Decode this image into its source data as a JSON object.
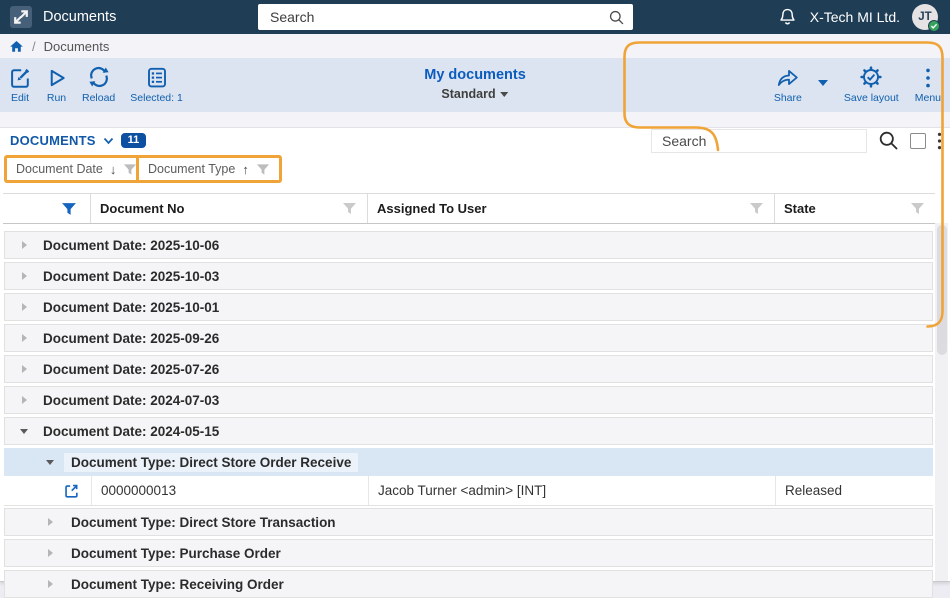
{
  "topbar": {
    "app_title": "Documents",
    "search_placeholder": "Search",
    "company": "X-Tech MI Ltd.",
    "avatar_initials": "JT"
  },
  "breadcrumb": {
    "separator": "/",
    "current": "Documents"
  },
  "toolbar": {
    "left": [
      {
        "label": "Edit"
      },
      {
        "label": "Run"
      },
      {
        "label": "Reload"
      },
      {
        "label": "Selected: 1"
      }
    ],
    "center": {
      "title": "My documents",
      "subtitle": "Standard"
    },
    "right": [
      {
        "label": "Share"
      },
      {
        "label": "Save layout"
      },
      {
        "label": "Menu"
      }
    ]
  },
  "grid": {
    "title": "DOCUMENTS",
    "count_badge": "11",
    "search_placeholder": "Search",
    "group_chips": [
      {
        "label": "Document Date",
        "sort_glyph": "↓"
      },
      {
        "label": "Document Type",
        "sort_glyph": "↑"
      }
    ],
    "columns": [
      "",
      "Document No",
      "Assigned To User",
      "State"
    ],
    "groups": [
      {
        "label": "Document Date: 2025-10-06",
        "expanded": false
      },
      {
        "label": "Document Date: 2025-10-03",
        "expanded": false
      },
      {
        "label": "Document Date: 2025-10-01",
        "expanded": false
      },
      {
        "label": "Document Date: 2025-09-26",
        "expanded": false
      },
      {
        "label": "Document Date: 2025-07-26",
        "expanded": false
      },
      {
        "label": "Document Date: 2024-07-03",
        "expanded": false
      },
      {
        "label": "Document Date: 2024-05-15",
        "expanded": true,
        "children": [
          {
            "label": "Document Type: Direct Store Order Receive",
            "expanded": true,
            "selected": true,
            "rows": [
              {
                "document_no": "0000000013",
                "assigned_to": "Jacob Turner <admin> [INT]",
                "state": "Released"
              }
            ]
          },
          {
            "label": "Document Type: Direct Store Transaction",
            "expanded": false
          },
          {
            "label": "Document Type: Purchase Order",
            "expanded": false
          },
          {
            "label": "Document Type: Receiving Order",
            "expanded": false
          }
        ]
      }
    ]
  },
  "colors": {
    "topbar_bg": "#203d56",
    "accent_blue": "#1160b0",
    "title_blue": "#0b5cbe",
    "toolbar_bg": "#dbe4f0",
    "badge_bg": "#0d4fa0",
    "selected_row_bg": "#d9e6f4",
    "annotation_orange": "#f0a437",
    "online_green": "#36a35c"
  }
}
